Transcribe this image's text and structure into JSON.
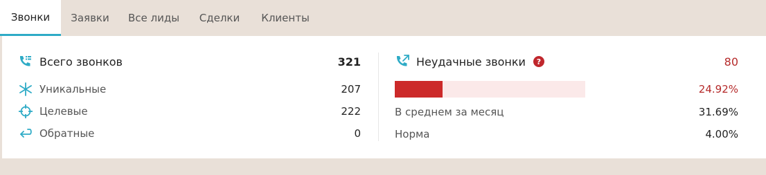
{
  "tabs": [
    {
      "label": "Звонки",
      "active": true
    },
    {
      "label": "Заявки",
      "active": false
    },
    {
      "label": "Все лиды",
      "active": false
    },
    {
      "label": "Сделки",
      "active": false
    },
    {
      "label": "Клиенты",
      "active": false
    }
  ],
  "calls": {
    "total_label": "Всего звонков",
    "total_value": "321",
    "unique_label": "Уникальные",
    "unique_value": "207",
    "target_label": "Целевые",
    "target_value": "222",
    "callback_label": "Обратные",
    "callback_value": "0"
  },
  "failed": {
    "title": "Неудачные звонки",
    "help_icon": "?",
    "count": "80",
    "percent": "24.92%",
    "percent_fraction": 0.2492,
    "avg_label": "В среднем за месяц",
    "avg_value": "31.69%",
    "norm_label": "Норма",
    "norm_value": "4.00%"
  },
  "colors": {
    "accent": "#2eabc6",
    "danger": "#cc2a2a",
    "danger_text": "#b52a2a",
    "bar_bg": "#fbe9e9"
  },
  "icons": {
    "total": "phone-list-icon",
    "unique": "asterisk-icon",
    "target": "crosshair-icon",
    "callback": "return-arrow-icon",
    "failed": "phone-missed-icon",
    "help": "question-circle-icon"
  }
}
